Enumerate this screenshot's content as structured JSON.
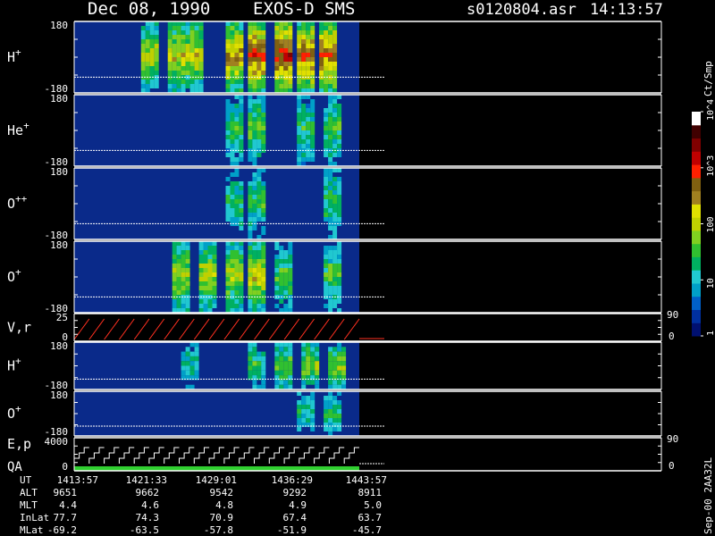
{
  "header": {
    "date": "Dec 08, 1990",
    "mission": "EXOS-D SMS",
    "file": "s0120804.asr",
    "time": "14:13:57"
  },
  "colorbar": {
    "unit": "Ct/Smp",
    "ticks": [
      "1",
      "10",
      "100",
      "10^3",
      "10^4"
    ],
    "tick_values": [
      1,
      10,
      100,
      1000,
      10000
    ],
    "colors": [
      "#001070",
      "#0030a0",
      "#0060c8",
      "#00a0c8",
      "#20c8d0",
      "#00b060",
      "#30c030",
      "#80d020",
      "#c0d000",
      "#e0e000",
      "#a08020",
      "#806010",
      "#ff2000",
      "#c00000",
      "#800000",
      "#400000",
      "#ffffff"
    ]
  },
  "panels": [
    {
      "label": "H",
      "sup": "+",
      "ymax": "180",
      "ymin": "-180"
    },
    {
      "label": "He",
      "sup": "+",
      "ymax": "180",
      "ymin": "-180"
    },
    {
      "label": "O",
      "sup": "++",
      "ymax": "180",
      "ymin": "-180"
    },
    {
      "label": "O",
      "sup": "+",
      "ymax": "180",
      "ymin": "-180"
    },
    {
      "label": "V,r",
      "sup": "",
      "ymax": "25",
      "ymin": "0",
      "right_top": "90",
      "right_bottom": "0"
    },
    {
      "label": "H",
      "sup": "+",
      "ymax": "180",
      "ymin": "-180"
    },
    {
      "label": "O",
      "sup": "+",
      "ymax": "180",
      "ymin": "-180"
    },
    {
      "label": "E,p",
      "label2": "QA",
      "sup": "",
      "ymax": "4000",
      "ymin": "0",
      "right_top": "90",
      "right_bottom": "0"
    }
  ],
  "footer": {
    "row_labels": [
      "UT",
      "ALT",
      "MLT",
      "InLat",
      "MLat"
    ],
    "columns": [
      {
        "UT": "1413:57",
        "ALT": "9651",
        "MLT": "4.4",
        "InLat": "77.7",
        "MLat": "-69.2"
      },
      {
        "UT": "1421:33",
        "ALT": "9662",
        "MLT": "4.6",
        "InLat": "74.3",
        "MLat": "-63.5"
      },
      {
        "UT": "1429:01",
        "ALT": "9542",
        "MLT": "4.8",
        "InLat": "70.9",
        "MLat": "-57.8"
      },
      {
        "UT": "1436:29",
        "ALT": "9292",
        "MLT": "4.9",
        "InLat": "67.4",
        "MLat": "-51.9"
      },
      {
        "UT": "1443:57",
        "ALT": "8911",
        "MLT": "5.0",
        "InLat": "63.7",
        "MLat": "-45.7"
      }
    ],
    "side_note": "Sep-00  2AA32L"
  },
  "chart_data": {
    "type": "heatmap",
    "title": "Dec 08, 1990   EXOS-D SMS",
    "x_unit": "UT",
    "x_ticks": [
      "1413:57",
      "1421:33",
      "1429:01",
      "1436:29",
      "1443:57"
    ],
    "ylim": [
      -180,
      180
    ],
    "colorscale": "log",
    "clim": [
      1,
      10000
    ],
    "bursts": [
      {
        "panel": 0,
        "x": 0.26,
        "intensity": 2.2
      },
      {
        "panel": 0,
        "x": 0.35,
        "intensity": 2.5
      },
      {
        "panel": 0,
        "x": 0.42,
        "intensity": 2.4
      },
      {
        "panel": 0,
        "x": 0.55,
        "intensity": 3.0
      },
      {
        "panel": 0,
        "x": 0.64,
        "intensity": 3.4
      },
      {
        "panel": 0,
        "x": 0.72,
        "intensity": 3.6
      },
      {
        "panel": 0,
        "x": 0.8,
        "intensity": 3.3
      },
      {
        "panel": 0,
        "x": 0.88,
        "intensity": 3.2
      },
      {
        "panel": 1,
        "x": 0.55,
        "intensity": 1.6
      },
      {
        "panel": 1,
        "x": 0.64,
        "intensity": 1.8
      },
      {
        "panel": 1,
        "x": 0.8,
        "intensity": 1.6
      },
      {
        "panel": 1,
        "x": 0.9,
        "intensity": 1.7
      },
      {
        "panel": 2,
        "x": 0.55,
        "intensity": 1.5
      },
      {
        "panel": 2,
        "x": 0.64,
        "intensity": 1.6
      },
      {
        "panel": 2,
        "x": 0.9,
        "intensity": 1.6
      },
      {
        "panel": 3,
        "x": 0.37,
        "intensity": 2.2
      },
      {
        "panel": 3,
        "x": 0.46,
        "intensity": 2.2
      },
      {
        "panel": 3,
        "x": 0.55,
        "intensity": 2.3
      },
      {
        "panel": 3,
        "x": 0.64,
        "intensity": 2.5
      },
      {
        "panel": 3,
        "x": 0.72,
        "intensity": 1.7
      },
      {
        "panel": 3,
        "x": 0.9,
        "intensity": 1.8
      },
      {
        "panel": 5,
        "x": 0.4,
        "intensity": 1.3
      },
      {
        "panel": 5,
        "x": 0.64,
        "intensity": 1.6
      },
      {
        "panel": 5,
        "x": 0.72,
        "intensity": 2.1
      },
      {
        "panel": 5,
        "x": 0.82,
        "intensity": 2.1
      },
      {
        "panel": 5,
        "x": 0.92,
        "intensity": 2.1
      },
      {
        "panel": 6,
        "x": 0.8,
        "intensity": 1.4
      },
      {
        "panel": 6,
        "x": 0.9,
        "intensity": 1.5
      }
    ],
    "vr_ramps": 19,
    "ep_steps": 19
  }
}
